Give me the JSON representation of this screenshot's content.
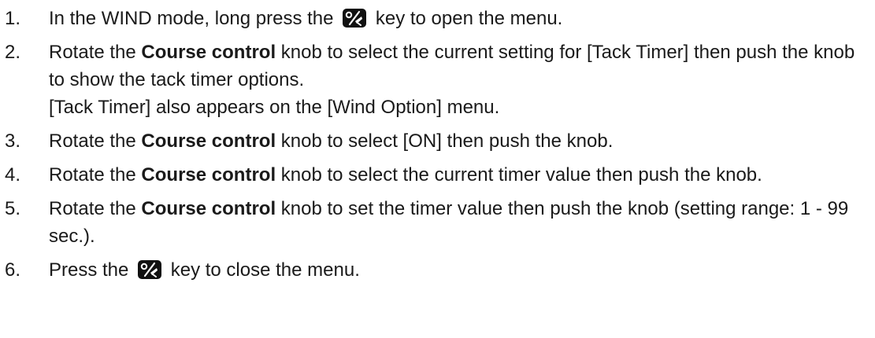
{
  "steps": [
    {
      "number": "1.",
      "before": "In the WIND mode, long press the",
      "icon": "menu-key-icon",
      "after": "key to open the menu."
    },
    {
      "number": "2.",
      "before": "Rotate the",
      "bold": "Course control",
      "after": "knob to select the current setting for [Tack Timer] then push the knob to show the tack timer options.",
      "note": "[Tack Timer] also appears on the [Wind Option] menu."
    },
    {
      "number": "3.",
      "before": "Rotate the",
      "bold": "Course control",
      "after": "knob to select [ON] then push the knob."
    },
    {
      "number": "4.",
      "before": "Rotate the",
      "bold": "Course control",
      "after": "knob to select the current timer value then push the knob."
    },
    {
      "number": "5.",
      "before": "Rotate the",
      "bold": "Course control",
      "after": "knob to set the timer value then push the knob (setting range: 1 - 99 sec.)."
    },
    {
      "number": "6.",
      "before": "Press the",
      "icon": "menu-key-icon",
      "after": "key to close the menu."
    }
  ],
  "colors": {
    "text": "#1a1a1a",
    "icon_fill": "#111111",
    "icon_symbol": "#ffffff"
  }
}
